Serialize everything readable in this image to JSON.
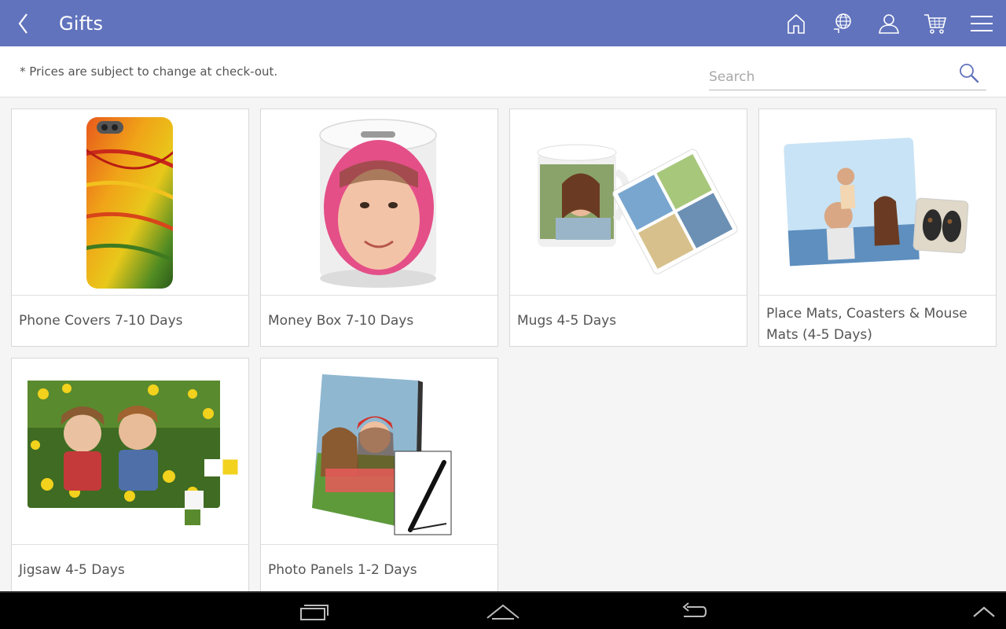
{
  "header": {
    "title": "Gifts"
  },
  "info": {
    "notice": "* Prices are subject to change at check-out."
  },
  "search": {
    "placeholder": "Search",
    "value": ""
  },
  "products": [
    {
      "label": "Phone Covers 7-10 Days"
    },
    {
      "label": "Money Box 7-10 Days"
    },
    {
      "label": "Mugs 4-5 Days"
    },
    {
      "label": "Place Mats, Coasters & Mouse Mats (4-5 Days)"
    },
    {
      "label": "Jigsaw 4-5 Days"
    },
    {
      "label": "Photo Panels 1-2 Days"
    }
  ],
  "icons": {
    "back": "chevron-left-icon",
    "home": "home-icon",
    "language": "globe-icon",
    "account": "user-icon",
    "cart": "cart-icon",
    "menu": "hamburger-menu-icon",
    "search": "search-icon"
  },
  "colors": {
    "appbar": "#6173bd",
    "background": "#f5f5f5",
    "navbar": "#000000"
  }
}
